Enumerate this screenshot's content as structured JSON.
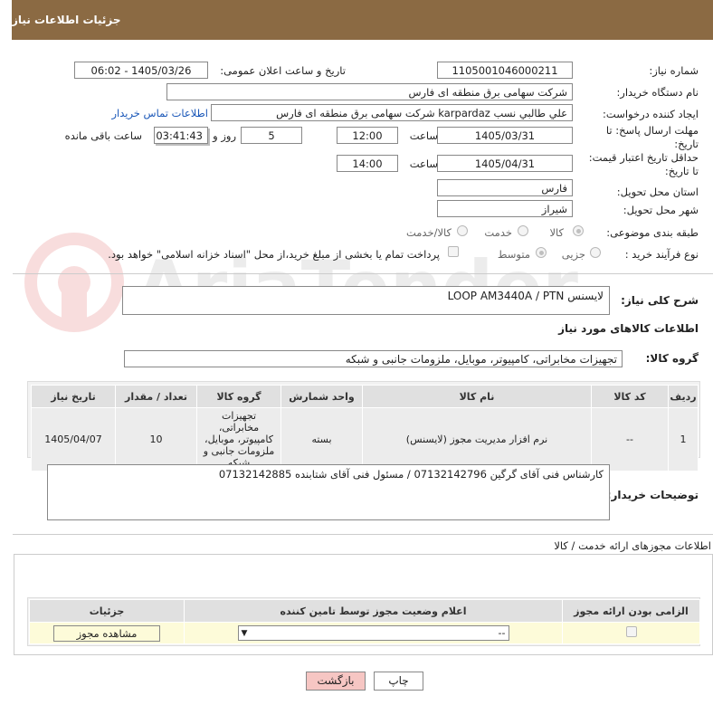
{
  "header": {
    "title": "جزئیات اطلاعات نیاز"
  },
  "watermark": {
    "text": "AriaTender.neT"
  },
  "fields": {
    "need_number_label": "شماره نیاز:",
    "need_number": "1105001046000211",
    "announce_label": "تاریخ و ساعت اعلان عمومی:",
    "announce_value": "1405/03/26 - 06:02",
    "buyer_org_label": "نام دستگاه خریدار:",
    "buyer_org": "شرکت سهامی برق منطقه ای فارس",
    "creator_label": "ایجاد کننده درخواست:",
    "creator": "علي طالبي نسب karpardaz شرکت سهامی برق منطقه ای فارس",
    "contact_link": "اطلاعات تماس خریدار",
    "deadline_label": "مهلت ارسال پاسخ: تا تاریخ:",
    "deadline_date": "1405/03/31",
    "hour_label": "ساعت",
    "deadline_time": "12:00",
    "days": "5",
    "days_label": "روز و",
    "remaining_time": "03:41:43",
    "remaining_label": "ساعت باقی مانده",
    "validity_label": "حداقل تاریخ اعتبار قیمت: تا تاریخ:",
    "validity_date": "1405/04/31",
    "validity_time": "14:00",
    "province_label": "استان محل تحویل:",
    "province": "فارس",
    "city_label": "شهر محل تحویل:",
    "city": "شیراز",
    "category_label": "طبقه بندی موضوعی:",
    "category_options": [
      "کالا",
      "خدمت",
      "کالا/خدمت"
    ],
    "process_label": "نوع فرآیند خرید :",
    "process_options": [
      "جزیی",
      "متوسط"
    ],
    "payment_note": "پرداخت تمام یا بخشی از مبلغ خرید،از محل \"اسناد خزانه اسلامی\" خواهد بود."
  },
  "description": {
    "label": "شرح کلی نیاز:",
    "value": "لایسنس LOOP AM3440A / PTN"
  },
  "goods": {
    "section_title": "اطلاعات کالاهای مورد نیاز",
    "group_label": "گروه کالا:",
    "group_value": "تجهیزات مخابراتی، کامپیوتر، موبایل، ملزومات جانبی و شبکه",
    "columns": [
      "ردیف",
      "کد کالا",
      "نام کالا",
      "واحد شمارش",
      "گروه کالا",
      "تعداد / مقدار",
      "تاریخ نیاز"
    ],
    "rows": [
      [
        "1",
        "--",
        "نرم افزار مدیریت مجوز (لایسنس)",
        "بسته",
        "تجهیزات مخابراتی، کامپیوتر، موبایل، ملزومات جانبی و شبکه",
        "10",
        "1405/04/07"
      ]
    ]
  },
  "buyer_notes": {
    "label": "توضیحات خریدار:",
    "value": "کارشناس فنی آقای گرگین 07132142796 / مسئول فنی آقای شتابنده 07132142885"
  },
  "licenses": {
    "title": "اطلاعات مجوزهای ارائه خدمت / کالا",
    "columns": [
      "الزامی بودن ارائه مجوز",
      "اعلام وضعیت مجوز توسط تامین کننده",
      "جزئیات"
    ],
    "select_value": "--",
    "view_button": "مشاهده مجوز"
  },
  "footer": {
    "print": "چاپ",
    "back": "بازگشت"
  },
  "colors": {
    "header": "#8b6a43",
    "back_button": "#f6c6c3",
    "row_yellow": "#fdfbd9"
  }
}
